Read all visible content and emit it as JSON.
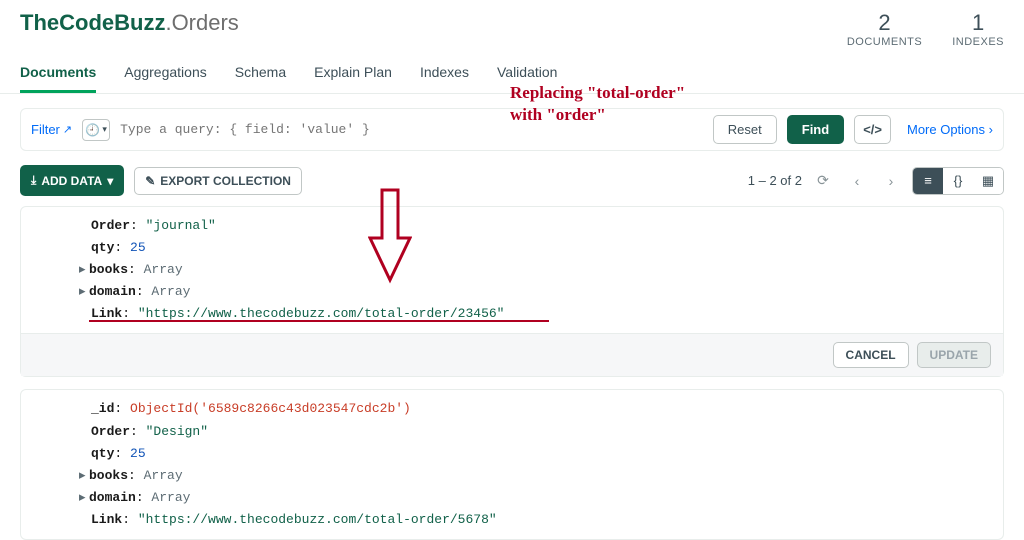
{
  "header": {
    "db": "TheCodeBuzz",
    "coll": ".Orders",
    "stats": [
      {
        "num": "2",
        "lbl": "DOCUMENTS"
      },
      {
        "num": "1",
        "lbl": "INDEXES"
      }
    ]
  },
  "tabs": [
    "Documents",
    "Aggregations",
    "Schema",
    "Explain Plan",
    "Indexes",
    "Validation"
  ],
  "active_tab": 0,
  "annotation": {
    "line1": "Replacing \"total-order\"",
    "line2": "with \"order\""
  },
  "querybar": {
    "filter_label": "Filter",
    "placeholder": "Type a query: { field: 'value' }",
    "reset": "Reset",
    "find": "Find",
    "code": "</>",
    "more": "More Options"
  },
  "toolbar": {
    "add_data": "ADD DATA",
    "export": "EXPORT COLLECTION",
    "pager": "1 – 2 of 2",
    "view_json_label": "{}"
  },
  "doc1": {
    "order_k": "Order",
    "order_v": "\"journal\"",
    "qty_k": "qty",
    "qty_v": "25",
    "books_k": "books",
    "books_v": "Array",
    "domain_k": "domain",
    "domain_v": "Array",
    "link_k": "Link",
    "link_v": "\"https://www.thecodebuzz.com/total-order/23456\"",
    "cancel": "CANCEL",
    "update": "UPDATE"
  },
  "doc2": {
    "id_k": "_id",
    "id_v": "ObjectId('6589c8266c43d023547cdc2b')",
    "order_k": "Order",
    "order_v": "\"Design\"",
    "qty_k": "qty",
    "qty_v": "25",
    "books_k": "books",
    "books_v": "Array",
    "domain_k": "domain",
    "domain_v": "Array",
    "link_k": "Link",
    "link_v": "\"https://www.thecodebuzz.com/total-order/5678\""
  }
}
